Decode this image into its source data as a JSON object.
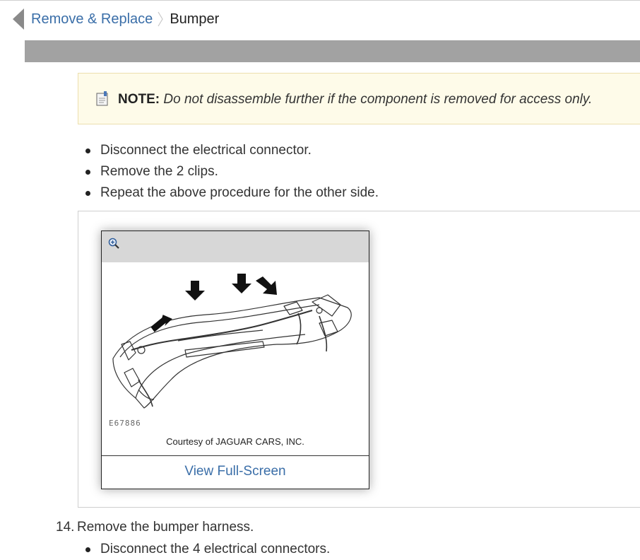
{
  "breadcrumb": {
    "parent": "Remove & Replace",
    "current": "Bumper"
  },
  "note": {
    "label": "NOTE:",
    "text": "Do not disassemble further if the component is removed for access only."
  },
  "steps": [
    "Disconnect the electrical connector.",
    "Remove the 2 clips.",
    "Repeat the above procedure for the other side."
  ],
  "figure": {
    "code": "E67886",
    "caption": "Courtesy of JAGUAR CARS, INC.",
    "fullscreen_label": "View Full-Screen"
  },
  "step14": {
    "number": "14.",
    "text": "Remove the bumper harness.",
    "substeps": [
      "Disconnect the 4 electrical connectors."
    ]
  },
  "colors": {
    "link": "#3a6ea8",
    "note_bg": "#fefbe9",
    "band": "#a2a2a2"
  },
  "icons": [
    "back-arrow-icon",
    "note-icon",
    "zoom-in-icon",
    "chevron-right-icon"
  ]
}
